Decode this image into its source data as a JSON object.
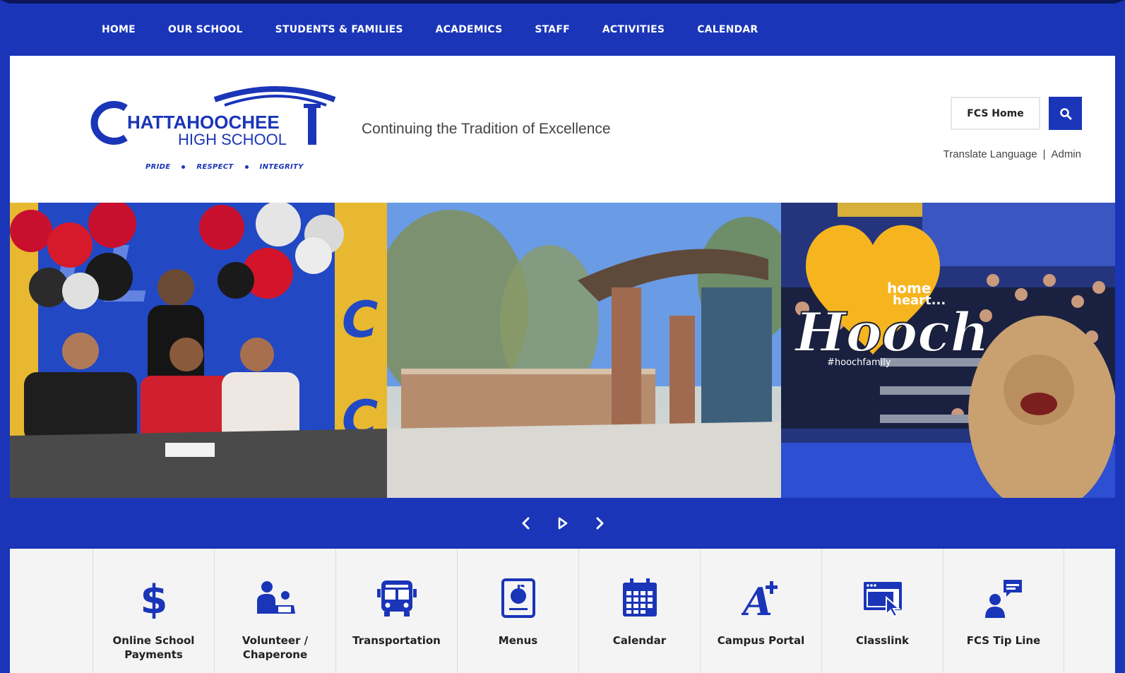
{
  "nav": {
    "items": [
      {
        "label": "HOME"
      },
      {
        "label": "OUR SCHOOL"
      },
      {
        "label": "STUDENTS & FAMILIES"
      },
      {
        "label": "ACADEMICS"
      },
      {
        "label": "STAFF"
      },
      {
        "label": "ACTIVITIES"
      },
      {
        "label": "CALENDAR"
      }
    ]
  },
  "header": {
    "logo": {
      "name_line1": "CHATTAHOOCHEE",
      "name_line2": "HIGH SCHOOL",
      "mottos": [
        "PRIDE",
        "RESPECT",
        "INTEGRITY"
      ]
    },
    "tagline": "Continuing the Tradition of Excellence",
    "fcs_home_label": "FCS Home",
    "translate_label": "Translate Language",
    "separator": "|",
    "admin_label": "Admin"
  },
  "banner": {
    "photo3_text_line1": "home",
    "photo3_text_line2": "heart...",
    "photo3_script": "Hooch",
    "photo3_hashtag": "#hoochfamily"
  },
  "quicklinks": [
    {
      "label": "Online School Payments",
      "icon": "dollar-icon"
    },
    {
      "label": "Volunteer / Chaperone",
      "icon": "volunteer-icon"
    },
    {
      "label": "Transportation",
      "icon": "bus-icon"
    },
    {
      "label": "Menus",
      "icon": "apple-menu-icon"
    },
    {
      "label": "Calendar",
      "icon": "calendar-icon"
    },
    {
      "label": "Campus Portal",
      "icon": "grade-a-plus-icon"
    },
    {
      "label": "Classlink",
      "icon": "browser-cursor-icon"
    },
    {
      "label": "FCS Tip Line",
      "icon": "person-chat-icon"
    }
  ],
  "colors": {
    "brand_blue": "#1a35b8",
    "header_bg": "#ffffff",
    "quicklinks_bg": "#f4f4f4"
  }
}
